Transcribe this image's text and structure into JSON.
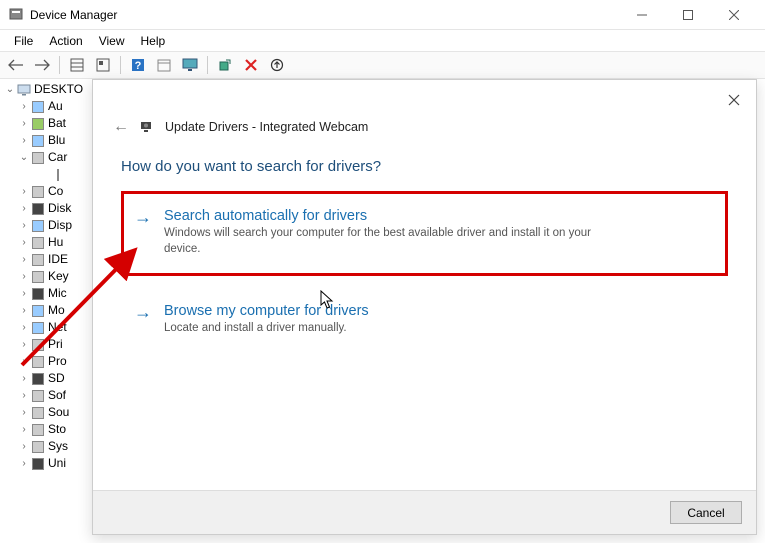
{
  "window": {
    "title": "Device Manager"
  },
  "menu": {
    "file": "File",
    "action": "Action",
    "view": "View",
    "help": "Help"
  },
  "tree": {
    "root": "DESKTO",
    "nodes": [
      "Au",
      "Bat",
      "Blu",
      "Car",
      "",
      "Co",
      "Disk",
      "Disp",
      "Hu",
      "IDE",
      "Key",
      "Mic",
      "Mo",
      "Net",
      "Pri",
      "Pro",
      "SD",
      "Sof",
      "Sou",
      "Sto",
      "Sys",
      "Uni"
    ]
  },
  "dialog": {
    "title": "Update Drivers - Integrated Webcam",
    "question": "How do you want to search for drivers?",
    "options": [
      {
        "title": "Search automatically for drivers",
        "desc": "Windows will search your computer for the best available driver and install it on your device."
      },
      {
        "title": "Browse my computer for drivers",
        "desc": "Locate and install a driver manually."
      }
    ],
    "cancel": "Cancel"
  }
}
